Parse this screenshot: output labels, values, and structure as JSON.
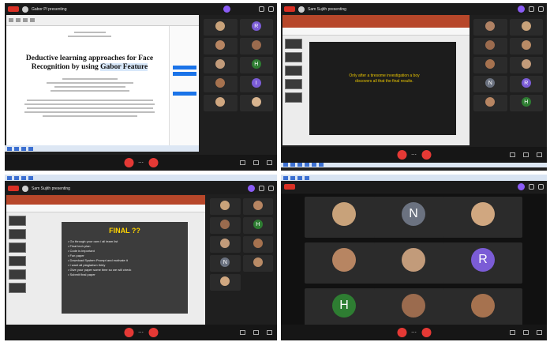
{
  "q1": {
    "meeting_title": "Gabor Pl presenting",
    "doc_title_line1": "Deductive learning approaches for Face",
    "doc_title_line2": "Recognition by using",
    "doc_title_highlight": "Gabor Feature",
    "participants": [
      {
        "initial": "",
        "color": "#c8a27a"
      },
      {
        "initial": "R",
        "color": "#7b5cd6"
      },
      {
        "initial": "",
        "color": "#b78562"
      },
      {
        "initial": "",
        "color": "#9b6b4e"
      },
      {
        "initial": "",
        "color": "#c29b7a"
      },
      {
        "initial": "H",
        "color": "#2e7d32"
      },
      {
        "initial": "",
        "color": "#a6724f"
      },
      {
        "initial": "I",
        "color": "#7b5cd6"
      },
      {
        "initial": "",
        "color": "#d0a780"
      },
      {
        "initial": "",
        "color": "#d8b48f"
      }
    ]
  },
  "q2": {
    "meeting_title": "Sam Sujith presenting",
    "slide_text": "Only after a tiresome investigation a boy discovers all that the final results.",
    "participants": [
      {
        "initial": "",
        "color": "#b08264"
      },
      {
        "initial": "",
        "color": "#c8a27a"
      },
      {
        "initial": "",
        "color": "#9b6b4e"
      },
      {
        "initial": "",
        "color": "#b98b66"
      },
      {
        "initial": "",
        "color": "#a6724f"
      },
      {
        "initial": "",
        "color": "#c29b7a"
      },
      {
        "initial": "N",
        "color": "#6b7280"
      },
      {
        "initial": "R",
        "color": "#7b5cd6"
      },
      {
        "initial": "",
        "color": "#b78562"
      },
      {
        "initial": "H",
        "color": "#2e7d32"
      }
    ]
  },
  "q3": {
    "meeting_title": "Sam Sujith presenting",
    "slide_title": "FINAL ??",
    "bullets": [
      "Go through your own / all team list",
      "Final tech plan",
      "Code is important",
      "Fun paper",
      "Download System Prompt and motivate it",
      "I want all plagiarism thirty",
      "Give your paper some time so we will check",
      "Submit final paper"
    ],
    "participants": [
      {
        "initial": "",
        "color": "#c8a27a"
      },
      {
        "initial": "",
        "color": "#b78562"
      },
      {
        "initial": "",
        "color": "#9b6b4e"
      },
      {
        "initial": "H",
        "color": "#2e7d32"
      },
      {
        "initial": "",
        "color": "#c29b7a"
      },
      {
        "initial": "",
        "color": "#a6724f"
      },
      {
        "initial": "N",
        "color": "#6b7280"
      },
      {
        "initial": "",
        "color": "#b98b66"
      },
      {
        "initial": "",
        "color": "#d0a780"
      }
    ]
  },
  "q4": {
    "gallery": [
      {
        "initial": "",
        "color": "#c8a27a"
      },
      {
        "initial": "N",
        "color": "#6b7280"
      },
      {
        "initial": "",
        "color": "#d0a780"
      },
      {
        "initial": "",
        "color": "#b78562"
      },
      {
        "initial": "",
        "color": "#c29b7a"
      },
      {
        "initial": "R",
        "color": "#7b5cd6"
      },
      {
        "initial": "H",
        "color": "#2e7d32"
      },
      {
        "initial": "",
        "color": "#9b6b4e"
      },
      {
        "initial": "",
        "color": "#a6724f"
      }
    ]
  },
  "colors": {
    "meet_bg": "#1f1f1f",
    "end_call": "#e53935",
    "ppt_ribbon": "#b7472a",
    "slide_accent": "#ffd400"
  }
}
